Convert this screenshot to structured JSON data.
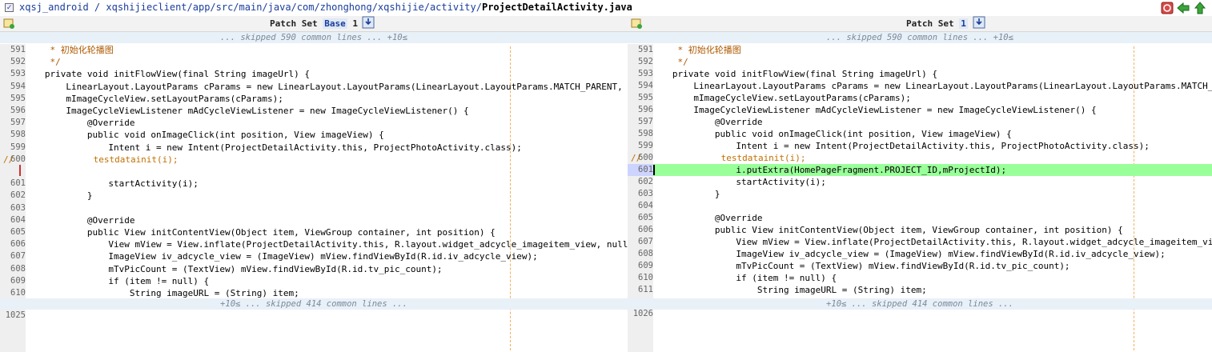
{
  "toolbar": {
    "path_prefix": "xqsj_android / xqshijieclient/app/src/main/java/com/zhonghong/xqshijie/activity/",
    "file_name": "ProjectDetailActivity.java",
    "icons": [
      "refresh-icon",
      "back-arrow-icon",
      "up-arrow-icon"
    ]
  },
  "left": {
    "header_label": "Patch Set",
    "header_selected": "Base",
    "header_num": "1",
    "skip_top": "... skipped 590 common lines ... +10≤",
    "skip_bottom": "+10≤ ... skipped 414 common lines ...",
    "end_line": "1025",
    "lines": [
      {
        "n": "591",
        "t": "    * 初始化轮播图",
        "c": "cm"
      },
      {
        "n": "592",
        "t": "    */",
        "c": "cm"
      },
      {
        "n": "593",
        "t": "   private void initFlowView(final String imageUrl) {",
        "c": ""
      },
      {
        "n": "594",
        "t": "       LinearLayout.LayoutParams cParams = new LinearLayout.LayoutParams(LinearLayout.LayoutParams.MATCH_PARENT, getScreenH",
        "c": ""
      },
      {
        "n": "595",
        "t": "       mImageCycleView.setLayoutParams(cParams);",
        "c": ""
      },
      {
        "n": "596",
        "t": "       ImageCycleViewListener mAdCycleViewListener = new ImageCycleViewListener() {",
        "c": ""
      },
      {
        "n": "597",
        "t": "           @Override",
        "c": ""
      },
      {
        "n": "598",
        "t": "           public void onImageClick(int position, View imageView) {",
        "c": ""
      },
      {
        "n": "599",
        "t": "               Intent i = new Intent(ProjectDetailActivity.this, ProjectPhotoActivity.class);",
        "c": ""
      },
      {
        "n": "600",
        "t": "//               testdatainit(i);",
        "c": "cd"
      },
      {
        "n": "",
        "t": "",
        "c": ""
      },
      {
        "n": "601",
        "t": "               startActivity(i);",
        "c": ""
      },
      {
        "n": "602",
        "t": "           }",
        "c": ""
      },
      {
        "n": "603",
        "t": "",
        "c": ""
      },
      {
        "n": "604",
        "t": "           @Override",
        "c": ""
      },
      {
        "n": "605",
        "t": "           public View initContentView(Object item, ViewGroup container, int position) {",
        "c": ""
      },
      {
        "n": "606",
        "t": "               View mView = View.inflate(ProjectDetailActivity.this, R.layout.widget_adcycle_imageitem_view, null);",
        "c": ""
      },
      {
        "n": "607",
        "t": "               ImageView iv_adcycle_view = (ImageView) mView.findViewById(R.id.iv_adcycle_view);",
        "c": ""
      },
      {
        "n": "608",
        "t": "               mTvPicCount = (TextView) mView.findViewById(R.id.tv_pic_count);",
        "c": ""
      },
      {
        "n": "609",
        "t": "               if (item != null) {",
        "c": ""
      },
      {
        "n": "610",
        "t": "                   String imageURL = (String) item;",
        "c": ""
      }
    ]
  },
  "right": {
    "header_label": "Patch Set",
    "header_selected": "1",
    "skip_top": "... skipped 590 common lines ... +10≤",
    "skip_bottom": "+10≤ ... skipped 414 common lines ...",
    "end_line": "1026",
    "lines": [
      {
        "n": "591",
        "t": "    * 初始化轮播图",
        "c": "cm"
      },
      {
        "n": "592",
        "t": "    */",
        "c": "cm"
      },
      {
        "n": "593",
        "t": "   private void initFlowView(final String imageUrl) {",
        "c": ""
      },
      {
        "n": "594",
        "t": "       LinearLayout.LayoutParams cParams = new LinearLayout.LayoutParams(LinearLayout.LayoutParams.MATCH_PARENT, ge",
        "c": ""
      },
      {
        "n": "595",
        "t": "       mImageCycleView.setLayoutParams(cParams);",
        "c": ""
      },
      {
        "n": "596",
        "t": "       ImageCycleViewListener mAdCycleViewListener = new ImageCycleViewListener() {",
        "c": ""
      },
      {
        "n": "597",
        "t": "           @Override",
        "c": ""
      },
      {
        "n": "598",
        "t": "           public void onImageClick(int position, View imageView) {",
        "c": ""
      },
      {
        "n": "599",
        "t": "               Intent i = new Intent(ProjectDetailActivity.this, ProjectPhotoActivity.class);",
        "c": ""
      },
      {
        "n": "600",
        "t": "//               testdatainit(i);",
        "c": "cd"
      },
      {
        "n": "601",
        "t": "               i.putExtra(HomePageFragment.PROJECT_ID,mProjectId);",
        "c": "",
        "hl": true
      },
      {
        "n": "602",
        "t": "               startActivity(i);",
        "c": ""
      },
      {
        "n": "603",
        "t": "           }",
        "c": ""
      },
      {
        "n": "604",
        "t": "",
        "c": ""
      },
      {
        "n": "605",
        "t": "           @Override",
        "c": ""
      },
      {
        "n": "606",
        "t": "           public View initContentView(Object item, ViewGroup container, int position) {",
        "c": ""
      },
      {
        "n": "607",
        "t": "               View mView = View.inflate(ProjectDetailActivity.this, R.layout.widget_adcycle_imageitem_view, null);",
        "c": ""
      },
      {
        "n": "608",
        "t": "               ImageView iv_adcycle_view = (ImageView) mView.findViewById(R.id.iv_adcycle_view);",
        "c": ""
      },
      {
        "n": "609",
        "t": "               mTvPicCount = (TextView) mView.findViewById(R.id.tv_pic_count);",
        "c": ""
      },
      {
        "n": "610",
        "t": "               if (item != null) {",
        "c": ""
      },
      {
        "n": "611",
        "t": "                   String imageURL = (String) item;",
        "c": ""
      }
    ]
  }
}
